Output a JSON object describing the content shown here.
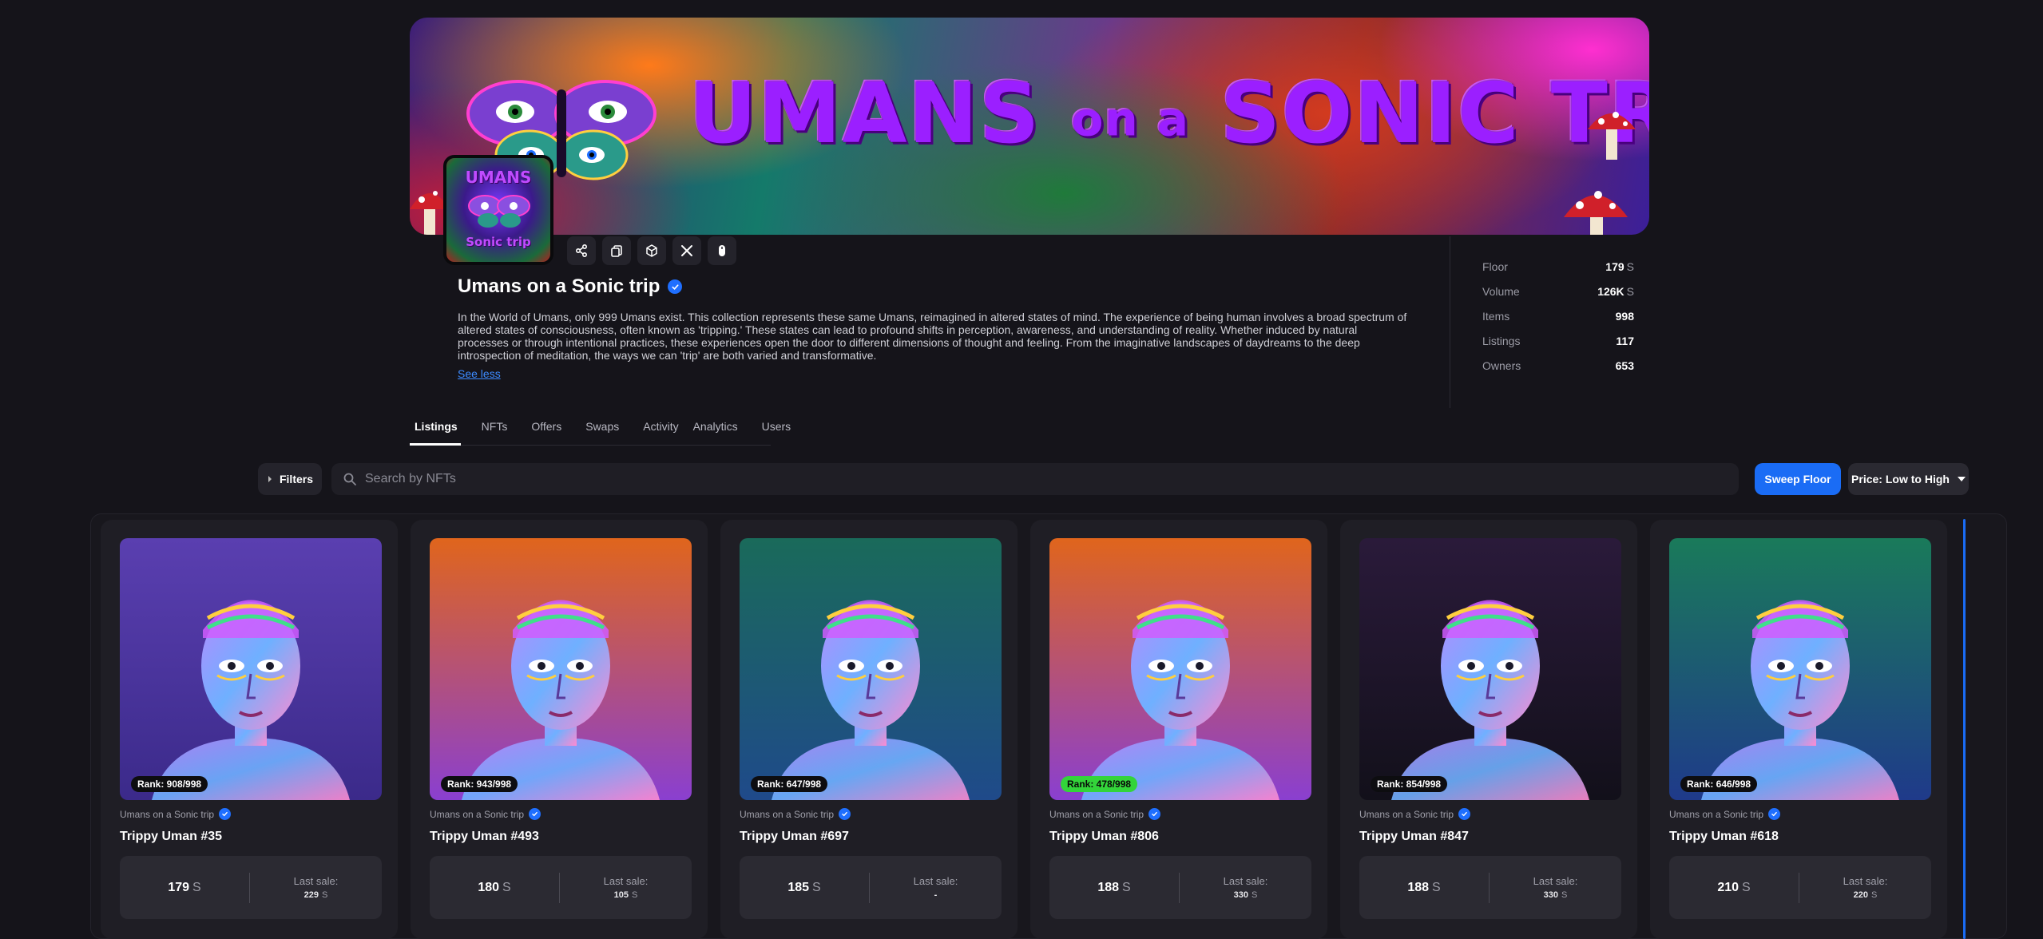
{
  "banner": {
    "title_part1": "UMANS",
    "title_part2": "on a",
    "title_part3": "SONIC TRIP"
  },
  "avatar": {
    "line1": "UMANS",
    "line2": "Sonic trip"
  },
  "actions": [
    "share-icon",
    "copy-icon",
    "cube-icon",
    "x-icon",
    "mouse-icon"
  ],
  "collection": {
    "name": "Umans on a Sonic trip",
    "description": "In the World of Umans, only 999 Umans exist. This collection represents these same Umans, reimagined in altered states of mind. The experience of being human involves a broad spectrum of altered states of consciousness, often known as 'tripping.' These states can lead to profound shifts in perception, awareness, and understanding of reality. Whether induced by natural processes or through intentional practices, these experiences open the door to different dimensions of thought and feeling. From the imaginative landscapes of daydreams to the deep introspection of meditation, the ways we can 'trip' are both varied and transformative.",
    "see_less": "See less"
  },
  "stats": [
    {
      "label": "Floor",
      "value": "179",
      "unit": "S"
    },
    {
      "label": "Volume",
      "value": "126K",
      "unit": "S"
    },
    {
      "label": "Items",
      "value": "998",
      "unit": ""
    },
    {
      "label": "Listings",
      "value": "117",
      "unit": ""
    },
    {
      "label": "Owners",
      "value": "653",
      "unit": ""
    }
  ],
  "tabs": [
    "Listings",
    "NFTs",
    "Offers",
    "Swaps",
    "Activity",
    "Analytics",
    "Users"
  ],
  "toolbar": {
    "filters_label": "Filters",
    "search_placeholder": "Search by NFTs",
    "sweep_label": "Sweep Floor",
    "sort_label": "Price: Low to High"
  },
  "cards": [
    {
      "rank": "Rank: 908/998",
      "rank_highlight": false,
      "collection": "Umans on a Sonic trip",
      "name": "Trippy Uman #35",
      "price": "179",
      "unit": "S",
      "last_sale_label": "Last sale:",
      "last_sale": "229",
      "last_sale_unit": "S",
      "bg_top": "#5a3fb0",
      "bg_bottom": "#3b2a8a"
    },
    {
      "rank": "Rank: 943/998",
      "rank_highlight": false,
      "collection": "Umans on a Sonic trip",
      "name": "Trippy Uman #493",
      "price": "180",
      "unit": "S",
      "last_sale_label": "Last sale:",
      "last_sale": "105",
      "last_sale_unit": "S",
      "bg_top": "#e0651c",
      "bg_bottom": "#8a3fd0"
    },
    {
      "rank": "Rank: 647/998",
      "rank_highlight": false,
      "collection": "Umans on a Sonic trip",
      "name": "Trippy Uman #697",
      "price": "185",
      "unit": "S",
      "last_sale_label": "Last sale:",
      "last_sale": "-",
      "last_sale_unit": "",
      "bg_top": "#1a6a5a",
      "bg_bottom": "#1f4a8a"
    },
    {
      "rank": "Rank: 478/998",
      "rank_highlight": true,
      "collection": "Umans on a Sonic trip",
      "name": "Trippy Uman #806",
      "price": "188",
      "unit": "S",
      "last_sale_label": "Last sale:",
      "last_sale": "330",
      "last_sale_unit": "S",
      "bg_top": "#e0651c",
      "bg_bottom": "#8a3fd0"
    },
    {
      "rank": "Rank: 854/998",
      "rank_highlight": false,
      "collection": "Umans on a Sonic trip",
      "name": "Trippy Uman #847",
      "price": "188",
      "unit": "S",
      "last_sale_label": "Last sale:",
      "last_sale": "330",
      "last_sale_unit": "S",
      "bg_top": "#2a1a3a",
      "bg_bottom": "#12101a"
    },
    {
      "rank": "Rank: 646/998",
      "rank_highlight": false,
      "collection": "Umans on a Sonic trip",
      "name": "Trippy Uman #618",
      "price": "210",
      "unit": "S",
      "last_sale_label": "Last sale:",
      "last_sale": "220",
      "last_sale_unit": "S",
      "bg_top": "#1a7a5a",
      "bg_bottom": "#1f3a8a"
    }
  ]
}
